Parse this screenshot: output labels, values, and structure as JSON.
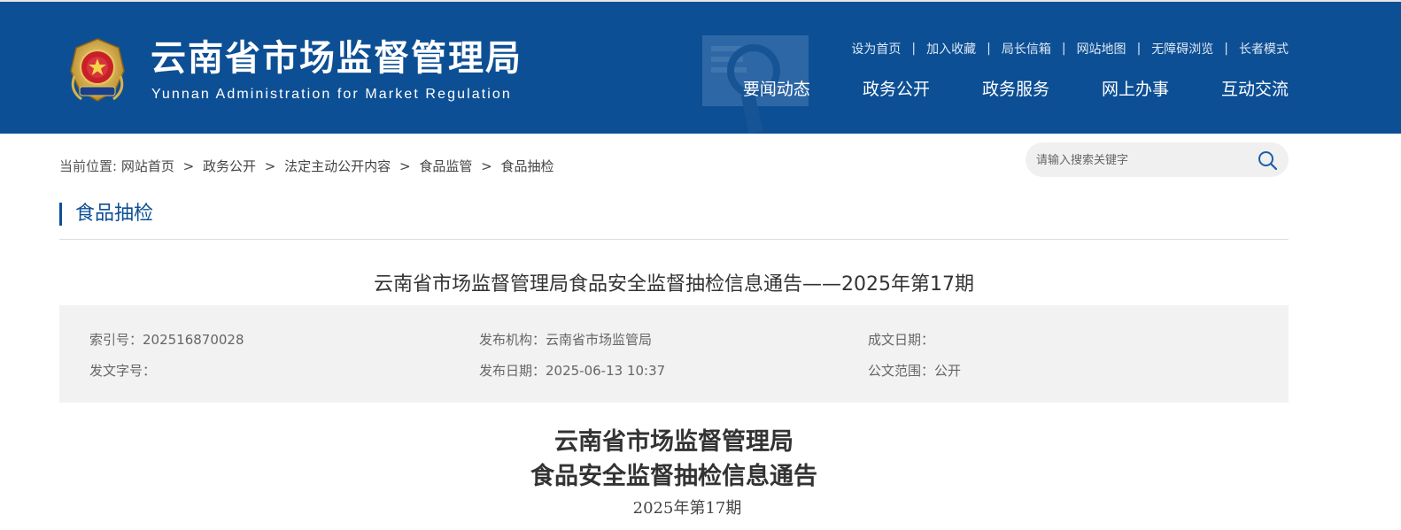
{
  "header": {
    "site_title": "云南省市场监督管理局",
    "site_subtitle": "Yunnan Administration for Market Regulation",
    "emblem_icon": "national-emblem-icon",
    "top_links": [
      "设为首页",
      "加入收藏",
      "局长信箱",
      "网站地图",
      "无障碍浏览",
      "长者模式"
    ],
    "top_link_separator": "|",
    "nav": [
      "要闻动态",
      "政务公开",
      "政务服务",
      "网上办事",
      "互动交流"
    ]
  },
  "breadcrumb": {
    "prefix": "当前位置:",
    "items": [
      "网站首页",
      "政务公开",
      "法定主动公开内容",
      "食品监管",
      "食品抽检"
    ],
    "separator": ">"
  },
  "search": {
    "placeholder": "请输入搜索关键字",
    "icon": "search-icon"
  },
  "section": {
    "heading": "食品抽检"
  },
  "article": {
    "title": "云南省市场监督管理局食品安全监督抽检信息通告——2025年第17期",
    "meta": {
      "index_no": "索引号：202516870028",
      "publisher": "发布机构：云南省市场监管局",
      "created_date": "成文日期：",
      "doc_no": "发文字号：",
      "publish_date": "发布日期：2025-06-13 10:37",
      "scope": "公文范围：公开"
    },
    "doc_title_line1": "云南省市场监督管理局",
    "doc_title_line2": "食品安全监督抽检信息通告",
    "doc_issue": "2025年第17期"
  },
  "colors": {
    "header_bg": "#0d4f94",
    "accent": "#0d4f94",
    "meta_bg": "#f2f2f2"
  }
}
